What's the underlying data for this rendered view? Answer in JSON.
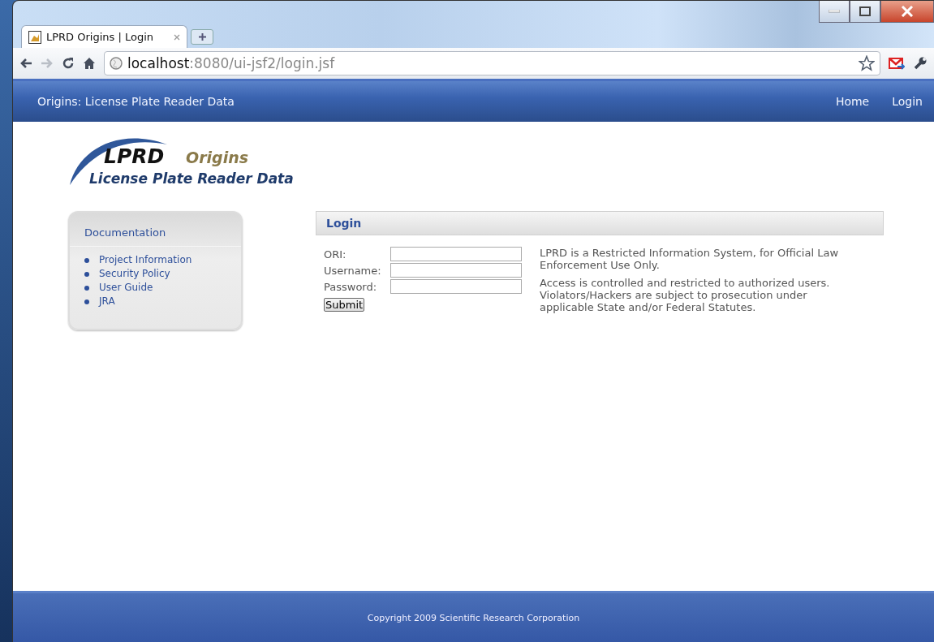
{
  "browser": {
    "tab_title": "LPRD Origins | Login",
    "url_host": "localhost",
    "url_rest": ":8080/ui-jsf2/login.jsf"
  },
  "navbar": {
    "title": "Origins: License Plate Reader Data",
    "links": [
      "Home",
      "Login"
    ]
  },
  "logo": {
    "short": "LPRD",
    "word": "Origins",
    "full": "License Plate Reader Data"
  },
  "sidebar": {
    "title": "Documentation",
    "items": [
      "Project Information",
      "Security Policy",
      "User Guide",
      "JRA"
    ]
  },
  "login": {
    "title": "Login",
    "fields": [
      {
        "label": "ORI:"
      },
      {
        "label": "Username:"
      },
      {
        "label": "Password:"
      }
    ],
    "submit": "Submit",
    "notice": [
      "LPRD is a Restricted Information System, for Official Law Enforcement Use Only.",
      "Access is controlled and restricted to authorized users. Violators/Hackers are subject to prosecution under applicable State and/or Federal Statutes."
    ]
  },
  "footer": "Copyright 2009 Scientific Research Corporation"
}
